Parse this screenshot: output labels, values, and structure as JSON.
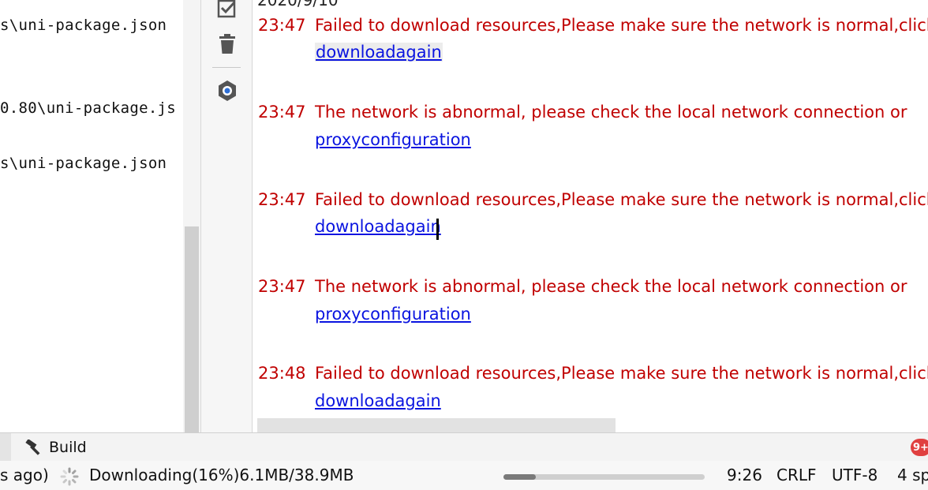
{
  "left_panel": {
    "lines": [
      "s\\uni-package.json",
      "0.80\\uni-package.js",
      "s\\uni-package.json"
    ]
  },
  "toolbar": {
    "icons": [
      "checklist-icon",
      "trash-icon",
      "settings-hex-icon"
    ]
  },
  "console": {
    "date_partial": "2020/9/10",
    "messages": [
      {
        "time": "23:47",
        "text": "Failed to download resources,Please make sure the network is normal,click to",
        "link": "downloadagain"
      },
      {
        "time": "23:47",
        "text": "The network is abnormal, please check the local network connection or",
        "link": "proxyconfiguration"
      },
      {
        "time": "23:47",
        "text": "Failed to download resources,Please make sure the network is normal,click to",
        "link": "downloadagain"
      },
      {
        "time": "23:47",
        "text": "The network is abnormal, please check the local network connection or",
        "link": "proxyconfiguration"
      },
      {
        "time": "23:48",
        "text": "Failed to download resources,Please make sure the network is normal,click to",
        "link": "downloadagain"
      }
    ]
  },
  "tabbar": {
    "build_label": "Build",
    "badge": "9+"
  },
  "statusbar": {
    "left_partial": "s ago)",
    "download_text": "Downloading(16%)6.1MB/38.9MB",
    "progress_percent": 16,
    "cursor_pos": "9:26",
    "line_ending": "CRLF",
    "encoding": "UTF-8",
    "indent_partial": "4 sp"
  },
  "colors": {
    "error_text": "#c00000",
    "link": "#0a14e0"
  }
}
